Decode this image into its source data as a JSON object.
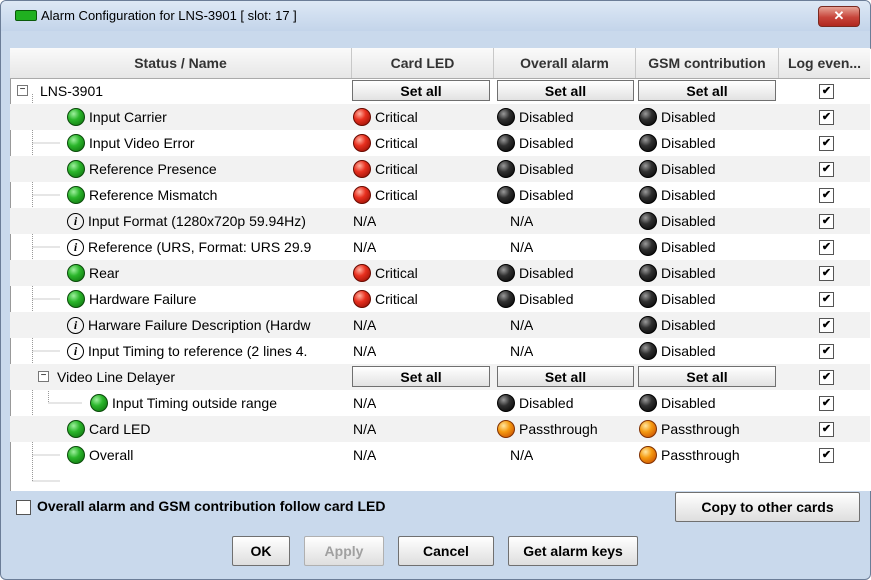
{
  "window": {
    "title": "Alarm Configuration for LNS-3901 [ slot: 17 ]",
    "close_label": "✕"
  },
  "columns": [
    "Status / Name",
    "Card LED",
    "Overall alarm",
    "GSM contribution",
    "Log even..."
  ],
  "set_all_label": "Set all",
  "rows": [
    {
      "name": "LNS-3901",
      "type": "group",
      "card_led": "",
      "overall": "",
      "gsm": "",
      "log": true
    },
    {
      "name": "Input Carrier",
      "icon": "green",
      "card_led": {
        "led": "red",
        "text": "Critical"
      },
      "overall": {
        "led": "black",
        "text": "Disabled"
      },
      "gsm": {
        "led": "black",
        "text": "Disabled"
      },
      "log": true
    },
    {
      "name": "Input Video Error",
      "icon": "green",
      "card_led": {
        "led": "red",
        "text": "Critical"
      },
      "overall": {
        "led": "black",
        "text": "Disabled"
      },
      "gsm": {
        "led": "black",
        "text": "Disabled"
      },
      "log": true
    },
    {
      "name": "Reference Presence",
      "icon": "green",
      "card_led": {
        "led": "red",
        "text": "Critical"
      },
      "overall": {
        "led": "black",
        "text": "Disabled"
      },
      "gsm": {
        "led": "black",
        "text": "Disabled"
      },
      "log": true
    },
    {
      "name": "Reference Mismatch",
      "icon": "green",
      "card_led": {
        "led": "red",
        "text": "Critical"
      },
      "overall": {
        "led": "black",
        "text": "Disabled"
      },
      "gsm": {
        "led": "black",
        "text": "Disabled"
      },
      "log": true
    },
    {
      "name": "Input Format (1280x720p 59.94Hz)",
      "icon": "info",
      "card_led": {
        "led": "",
        "text": "N/A"
      },
      "overall": {
        "led": "",
        "text": "N/A"
      },
      "gsm": {
        "led": "black",
        "text": "Disabled"
      },
      "log": true
    },
    {
      "name": "Reference (URS, Format: URS 29.9",
      "icon": "info",
      "card_led": {
        "led": "",
        "text": "N/A"
      },
      "overall": {
        "led": "",
        "text": "N/A"
      },
      "gsm": {
        "led": "black",
        "text": "Disabled"
      },
      "log": true
    },
    {
      "name": "Rear",
      "icon": "green",
      "card_led": {
        "led": "red",
        "text": "Critical"
      },
      "overall": {
        "led": "black",
        "text": "Disabled"
      },
      "gsm": {
        "led": "black",
        "text": "Disabled"
      },
      "log": true
    },
    {
      "name": "Hardware Failure",
      "icon": "green",
      "card_led": {
        "led": "red",
        "text": "Critical"
      },
      "overall": {
        "led": "black",
        "text": "Disabled"
      },
      "gsm": {
        "led": "black",
        "text": "Disabled"
      },
      "log": true
    },
    {
      "name": "Harware Failure Description (Hardw",
      "icon": "info",
      "card_led": {
        "led": "",
        "text": "N/A"
      },
      "overall": {
        "led": "",
        "text": "N/A"
      },
      "gsm": {
        "led": "black",
        "text": "Disabled"
      },
      "log": true
    },
    {
      "name": "Input Timing to reference (2 lines 4.",
      "icon": "info",
      "card_led": {
        "led": "",
        "text": "N/A"
      },
      "overall": {
        "led": "",
        "text": "N/A"
      },
      "gsm": {
        "led": "black",
        "text": "Disabled"
      },
      "log": true
    },
    {
      "name": "Video Line Delayer",
      "type": "subgroup",
      "card_led": "",
      "overall": "",
      "gsm": "",
      "log": true
    },
    {
      "name": "Input Timing outside range",
      "icon": "green",
      "indent": 2,
      "card_led": {
        "led": "",
        "text": "N/A"
      },
      "overall": {
        "led": "black",
        "text": "Disabled"
      },
      "gsm": {
        "led": "black",
        "text": "Disabled"
      },
      "log": true
    },
    {
      "name": "Card LED",
      "icon": "green",
      "card_led": {
        "led": "",
        "text": "N/A"
      },
      "overall": {
        "led": "orange",
        "text": "Passthrough"
      },
      "gsm": {
        "led": "orange",
        "text": "Passthrough"
      },
      "log": true
    },
    {
      "name": "Overall",
      "icon": "green",
      "card_led": {
        "led": "",
        "text": "N/A"
      },
      "overall": {
        "led": "",
        "text": "N/A"
      },
      "gsm": {
        "led": "orange",
        "text": "Passthrough"
      },
      "log": true
    }
  ],
  "footer": {
    "follow_label": "Overall alarm and GSM contribution follow card LED",
    "follow_checked": false,
    "copy_label": "Copy to other cards",
    "ok_label": "OK",
    "apply_label": "Apply",
    "cancel_label": "Cancel",
    "get_keys_label": "Get alarm keys"
  }
}
